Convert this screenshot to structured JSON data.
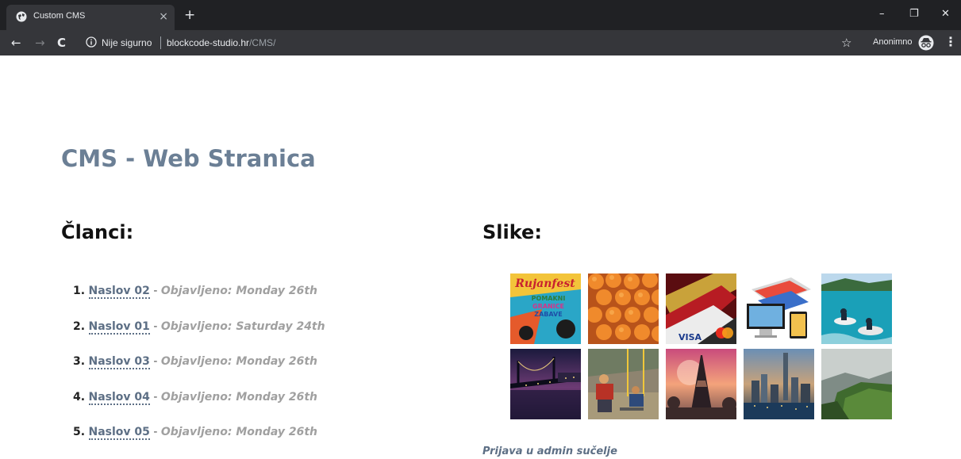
{
  "browser": {
    "tab_title": "Custom CMS",
    "tab_close": "×",
    "new_tab": "+",
    "security_label": "Nije sigurno",
    "url_host": "blockcode-studio.hr",
    "url_path": "/CMS/",
    "incognito_label": "Anonimno",
    "window_controls": {
      "minimize": "–",
      "restore": "❐",
      "close": "✕"
    }
  },
  "page": {
    "title": "CMS - Web Stranica",
    "articles_heading": "Članci:",
    "images_heading": "Slike:",
    "articles": [
      {
        "num": "1.",
        "title": "Naslov 02",
        "published": "Objavljeno: Monday 26th"
      },
      {
        "num": "2.",
        "title": "Naslov 01",
        "published": "Objavljeno: Saturday 24th"
      },
      {
        "num": "3.",
        "title": "Naslov 03",
        "published": "Objavljeno: Monday 26th"
      },
      {
        "num": "4.",
        "title": "Naslov 04",
        "published": "Objavljeno: Monday 26th"
      },
      {
        "num": "5.",
        "title": "Naslov 05",
        "published": "Objavljeno: Monday 26th"
      }
    ],
    "separator": " - ",
    "admin_link": "Prijava u admin sučelje",
    "poster_text": [
      "Rujanfest",
      "POMAKNI",
      "GRANICE",
      "ZABAVE"
    ],
    "card_text": "VISA"
  },
  "colors": {
    "chrome_dark": "#202124",
    "chrome_toolbar": "#35363a",
    "title_color": "#6b7f95",
    "link_color": "#5d6f85",
    "published_color": "#a0a0a0"
  }
}
